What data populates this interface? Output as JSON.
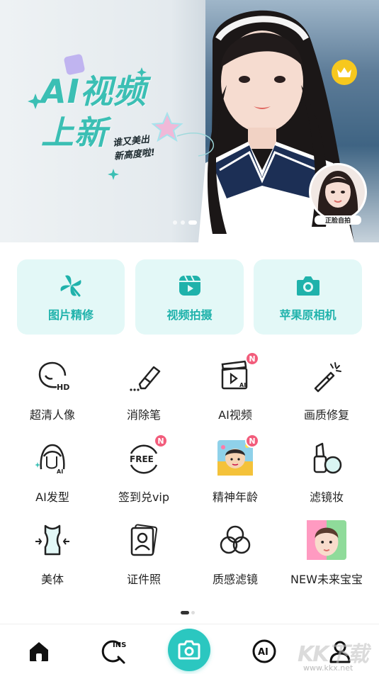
{
  "banner": {
    "title_line1": "AI视频",
    "title_line2": "上新",
    "subtitle_line1": "谁又美出",
    "subtitle_line2": "新高度啦!",
    "selfie_label": "正脸自拍",
    "slides": 4,
    "active_slide": 3
  },
  "cards": [
    {
      "label": "图片精修",
      "icon": "pinwheel-icon"
    },
    {
      "label": "视频拍摄",
      "icon": "video-play-icon"
    },
    {
      "label": "苹果原相机",
      "icon": "camera-icon"
    }
  ],
  "tools": [
    {
      "label": "超清人像",
      "icon": "hd-face-icon",
      "badge": ""
    },
    {
      "label": "消除笔",
      "icon": "eraser-icon",
      "badge": ""
    },
    {
      "label": "AI视频",
      "icon": "ai-video-icon",
      "badge": "N"
    },
    {
      "label": "画质修复",
      "icon": "magic-wand-icon",
      "badge": ""
    },
    {
      "label": "AI发型",
      "icon": "ai-hairstyle-icon",
      "badge": ""
    },
    {
      "label": "签到兑vip",
      "icon": "free-icon",
      "badge": "N"
    },
    {
      "label": "精神年龄",
      "icon": "mental-age-thumbnail",
      "badge": "N"
    },
    {
      "label": "滤镜妆",
      "icon": "lipstick-icon",
      "badge": ""
    },
    {
      "label": "美体",
      "icon": "body-shape-icon",
      "badge": ""
    },
    {
      "label": "证件照",
      "icon": "id-photo-icon",
      "badge": ""
    },
    {
      "label": "质感滤镜",
      "icon": "filter-circles-icon",
      "badge": ""
    },
    {
      "label": "NEW未来宝宝",
      "icon": "baby-thumbnail",
      "badge": ""
    }
  ],
  "icons": {
    "free_text": "FREE",
    "hd_text": "HD",
    "ai_text": "AI",
    "ins_text": "INS"
  },
  "colors": {
    "accent": "#2bc7c0",
    "card_bg": "#e3f8f7",
    "badge": "#f25c7b",
    "crown": "#f7c81e"
  },
  "nav": {
    "items": [
      "home-icon",
      "ins-search-icon",
      "camera-icon",
      "ai-icon",
      "profile-icon"
    ]
  },
  "watermark": {
    "text": "KK下载",
    "url": "www.kkx.net"
  }
}
